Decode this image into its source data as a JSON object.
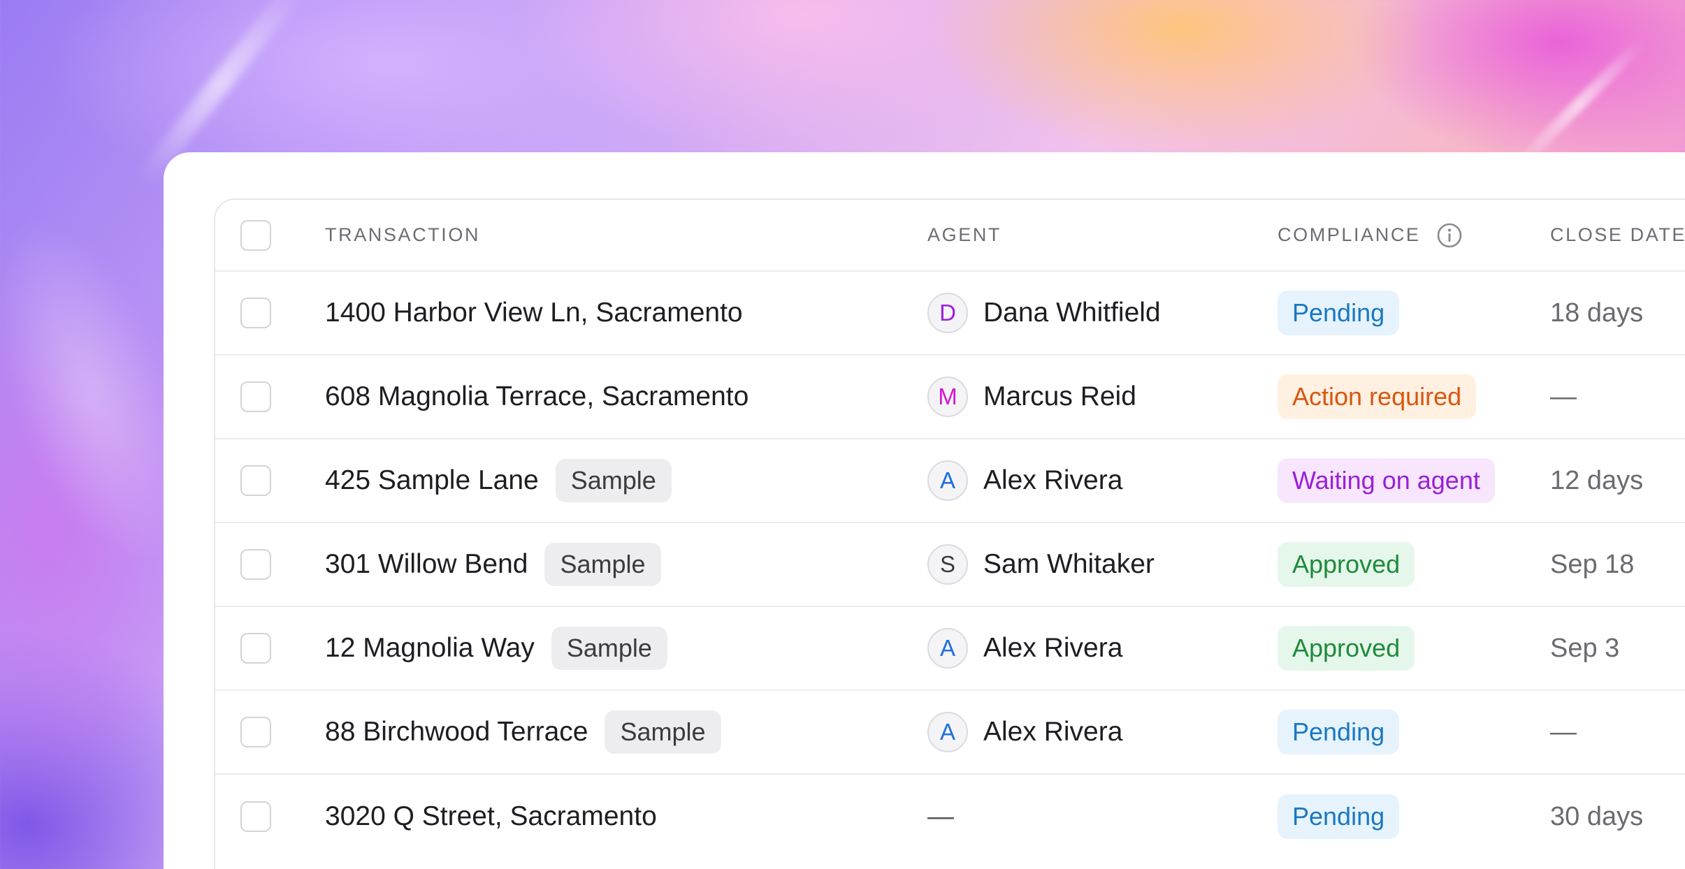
{
  "table": {
    "headers": {
      "transaction": "TRANSACTION",
      "agent": "AGENT",
      "compliance": "COMPLIANCE",
      "close_date": "CLOSE DATE"
    },
    "rows": [
      {
        "address": "1400 Harbor View Ln, Sacramento",
        "sample_badge": "",
        "agent_initial": "D",
        "agent_name": "Dana Whitfield",
        "agent_color": "#9b1fe0",
        "status": "Pending",
        "status_text_color": "#1a78c2",
        "status_bg_color": "#e6f3fd",
        "close": "18 days"
      },
      {
        "address": "608 Magnolia Terrace, Sacramento",
        "sample_badge": "",
        "agent_initial": "M",
        "agent_name": "Marcus Reid",
        "agent_color": "#d418d0",
        "status": "Action required",
        "status_text_color": "#d9560f",
        "status_bg_color": "#fff0e1",
        "close": "—"
      },
      {
        "address": "425 Sample Lane",
        "sample_badge": "Sample",
        "agent_initial": "A",
        "agent_name": "Alex Rivera",
        "agent_color": "#1f6fe0",
        "status": "Waiting on agent",
        "status_text_color": "#9a1fd8",
        "status_bg_color": "#f7e6fd",
        "close": "12 days"
      },
      {
        "address": "301 Willow Bend",
        "sample_badge": "Sample",
        "agent_initial": "S",
        "agent_name": "Sam Whitaker",
        "agent_color": "#3a3a40",
        "status": "Approved",
        "status_text_color": "#1f8a3c",
        "status_bg_color": "#e5f7ea",
        "close": "Sep 18"
      },
      {
        "address": "12 Magnolia Way",
        "sample_badge": "Sample",
        "agent_initial": "A",
        "agent_name": "Alex Rivera",
        "agent_color": "#1f6fe0",
        "status": "Approved",
        "status_text_color": "#1f8a3c",
        "status_bg_color": "#e5f7ea",
        "close": "Sep 3"
      },
      {
        "address": "88 Birchwood Terrace",
        "sample_badge": "Sample",
        "agent_initial": "A",
        "agent_name": "Alex Rivera",
        "agent_color": "#1f6fe0",
        "status": "Pending",
        "status_text_color": "#1a78c2",
        "status_bg_color": "#e6f3fd",
        "close": "—"
      },
      {
        "address": "3020 Q Street, Sacramento",
        "sample_badge": "",
        "agent_initial": "",
        "agent_name": "—",
        "agent_color": "",
        "status": "Pending",
        "status_text_color": "#1a78c2",
        "status_bg_color": "#e6f3fd",
        "close": "30 days"
      }
    ]
  },
  "icons": {
    "info": "info-icon",
    "checkbox": "checkbox-unchecked"
  }
}
